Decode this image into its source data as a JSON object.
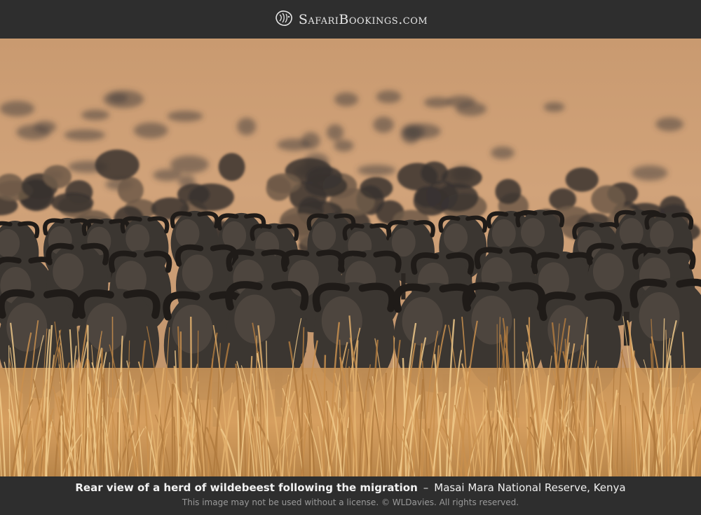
{
  "header": {
    "brand_text": "SafariBookings.com",
    "logo_icon": "lion-head-icon"
  },
  "photo": {
    "subject": "wildebeest herd"
  },
  "caption": {
    "title": "Rear view of a herd of wildebeest following the migration",
    "separator": "–",
    "location": "Masai Mara National Reserve, Kenya",
    "license": "This image may not be used without a license. © WLDavies. All rights reserved."
  },
  "colors": {
    "bar_background": "#2e2e2e",
    "grass": "#d9a15f",
    "wildebeest": "#3b3631"
  }
}
